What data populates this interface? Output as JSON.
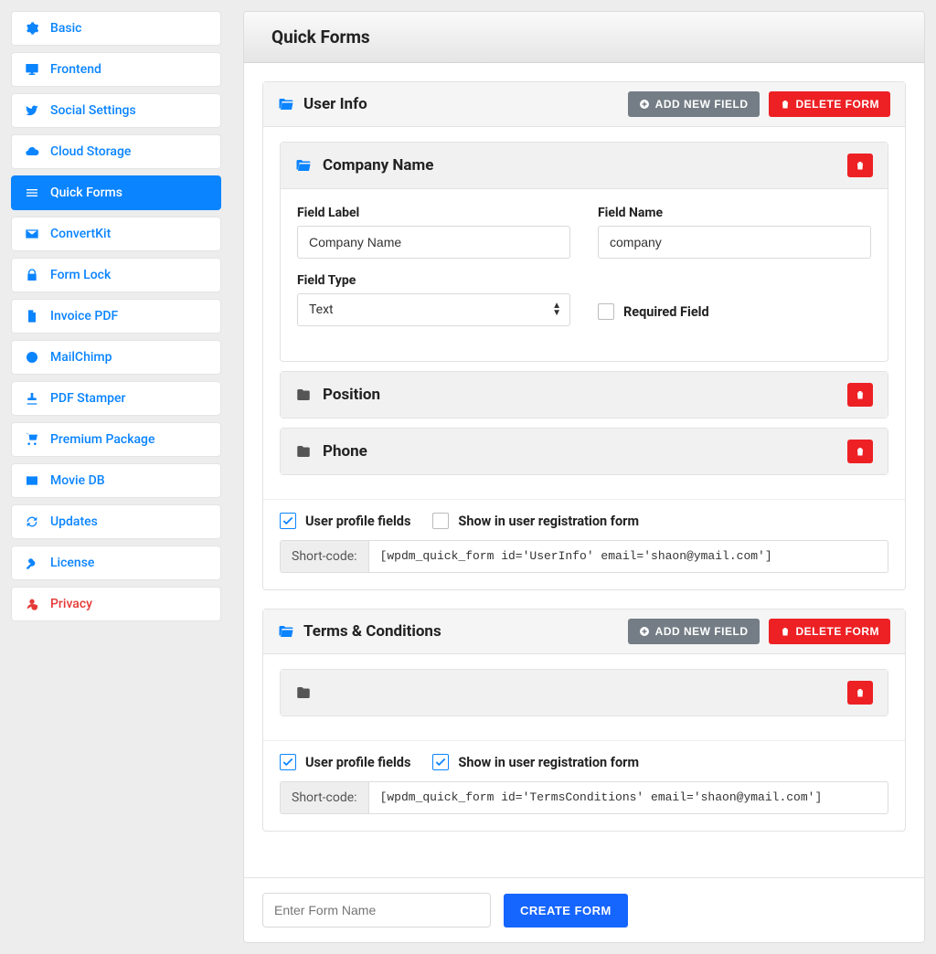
{
  "sidebar": {
    "items": [
      {
        "label": "Basic",
        "icon": "gear",
        "active": false
      },
      {
        "label": "Frontend",
        "icon": "monitor",
        "active": false
      },
      {
        "label": "Social Settings",
        "icon": "twitter",
        "active": false
      },
      {
        "label": "Cloud Storage",
        "icon": "cloud",
        "active": false
      },
      {
        "label": "Quick Forms",
        "icon": "bars",
        "active": true
      },
      {
        "label": "ConvertKit",
        "icon": "envelope",
        "active": false
      },
      {
        "label": "Form Lock",
        "icon": "lock",
        "active": false
      },
      {
        "label": "Invoice PDF",
        "icon": "file",
        "active": false
      },
      {
        "label": "MailChimp",
        "icon": "mailchimp",
        "active": false
      },
      {
        "label": "PDF Stamper",
        "icon": "stamp",
        "active": false
      },
      {
        "label": "Premium Package",
        "icon": "cart",
        "active": false
      },
      {
        "label": "Movie DB",
        "icon": "idcard",
        "active": false
      },
      {
        "label": "Updates",
        "icon": "refresh",
        "active": false
      },
      {
        "label": "License",
        "icon": "key",
        "active": false
      },
      {
        "label": "Privacy",
        "icon": "usershield",
        "active": false
      }
    ]
  },
  "page": {
    "title": "Quick Forms"
  },
  "buttons": {
    "add_field": "Add New Field",
    "delete_form": "Delete Form",
    "create_form": "Create Form"
  },
  "labels": {
    "field_label": "Field Label",
    "field_name": "Field Name",
    "field_type": "Field Type",
    "required": "Required Field",
    "user_profile": "User profile fields",
    "show_registration": "Show in user registration form",
    "shortcode": "Short-code:"
  },
  "form1": {
    "title": "User Info",
    "field0": {
      "title": "Company Name",
      "label_val": "Company Name",
      "name_val": "company",
      "type_val": "Text"
    },
    "field1": {
      "title": "Position"
    },
    "field2": {
      "title": "Phone"
    },
    "shortcode": "[wpdm_quick_form id='UserInfo' email='shaon@ymail.com']"
  },
  "form2": {
    "title": "Terms & Conditions",
    "shortcode": "[wpdm_quick_form id='TermsConditions' email='shaon@ymail.com']"
  },
  "create": {
    "placeholder": "Enter Form Name"
  }
}
